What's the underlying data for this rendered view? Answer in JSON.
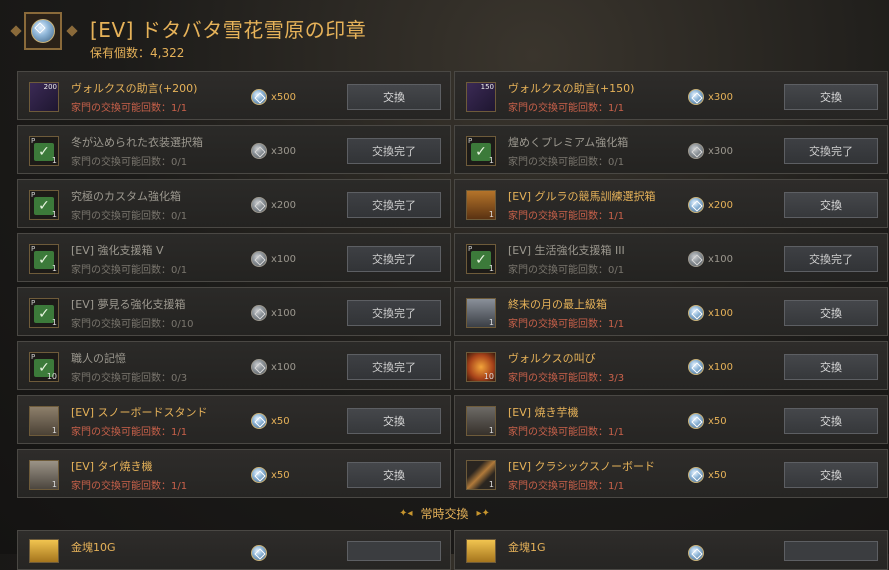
{
  "header": {
    "title": "[EV] ドタバタ雪花雪原の印章",
    "owned_label": "保有個数：",
    "owned_value": "4,322",
    "icon": "snowflake-seal-icon"
  },
  "colors": {
    "accent": "#e6b259",
    "limit_available": "#c9614a",
    "limit_exhausted": "#7a766e",
    "check": "#3c7a3a"
  },
  "items": [
    {
      "name": "ヴォルクスの助言(+200)",
      "limit": "家門の交換可能回数：1/1",
      "cost": "x500",
      "button": "交換",
      "done": false,
      "icon": "scroll-icon",
      "icon_number": "200"
    },
    {
      "name": "ヴォルクスの助言(+150)",
      "limit": "家門の交換可能回数：1/1",
      "cost": "x300",
      "button": "交換",
      "done": false,
      "icon": "scroll-icon",
      "icon_number": "150"
    },
    {
      "name": "冬が込められた衣装選択箱",
      "limit": "家門の交換可能回数：0/1",
      "cost": "x300",
      "button": "交換完了",
      "done": true,
      "icon": "check-icon"
    },
    {
      "name": "煌めくプレミアム強化箱",
      "limit": "家門の交換可能回数：0/1",
      "cost": "x300",
      "button": "交換完了",
      "done": true,
      "icon": "check-icon"
    },
    {
      "name": "究極のカスタム強化箱",
      "limit": "家門の交換可能回数：0/1",
      "cost": "x200",
      "button": "交換完了",
      "done": true,
      "icon": "check-icon"
    },
    {
      "name": "[EV] グルラの競馬訓練選択箱",
      "limit": "家門の交換可能回数：1/1",
      "cost": "x200",
      "button": "交換",
      "done": false,
      "icon": "treasure-chest-icon"
    },
    {
      "name": "[EV] 強化支援箱 V",
      "limit": "家門の交換可能回数：0/1",
      "cost": "x100",
      "button": "交換完了",
      "done": true,
      "icon": "check-icon"
    },
    {
      "name": "[EV] 生活強化支援箱 III",
      "limit": "家門の交換可能回数：0/1",
      "cost": "x100",
      "button": "交換完了",
      "done": true,
      "icon": "check-icon"
    },
    {
      "name": "[EV] 夢見る強化支援箱",
      "limit": "家門の交換可能回数：0/10",
      "cost": "x100",
      "button": "交換完了",
      "done": true,
      "icon": "check-icon"
    },
    {
      "name": "終末の月の最上級箱",
      "limit": "家門の交換可能回数：1/1",
      "cost": "x100",
      "button": "交換",
      "done": false,
      "icon": "metal-box-icon"
    },
    {
      "name": "職人の記憶",
      "limit": "家門の交換可能回数：0/3",
      "cost": "x100",
      "button": "交換完了",
      "done": true,
      "icon": "check-icon",
      "icon_number": "10"
    },
    {
      "name": "ヴォルクスの叫び",
      "limit": "家門の交換可能回数：3/3",
      "cost": "x100",
      "button": "交換",
      "done": false,
      "icon": "shout-orb-icon",
      "icon_number": "10"
    },
    {
      "name": "[EV] スノーボードスタンド",
      "limit": "家門の交換可能回数：1/1",
      "cost": "x50",
      "button": "交換",
      "done": false,
      "icon": "snowboard-stand-icon"
    },
    {
      "name": "[EV] 焼き芋機",
      "limit": "家門の交換可能回数：1/1",
      "cost": "x50",
      "button": "交換",
      "done": false,
      "icon": "sweet-potato-roaster-icon"
    },
    {
      "name": "[EV] タイ焼き機",
      "limit": "家門の交換可能回数：1/1",
      "cost": "x50",
      "button": "交換",
      "done": false,
      "icon": "taiyaki-machine-icon"
    },
    {
      "name": "[EV] クラシックスノーボード",
      "limit": "家門の交換可能回数：1/1",
      "cost": "x50",
      "button": "交換",
      "done": false,
      "icon": "snowboard-icon"
    }
  ],
  "section_divider": "常時交換",
  "bottom_items": [
    {
      "name": "金塊10G",
      "icon": "gold-bar-icon"
    },
    {
      "name": "金塊1G",
      "icon": "gold-bar-icon"
    }
  ]
}
